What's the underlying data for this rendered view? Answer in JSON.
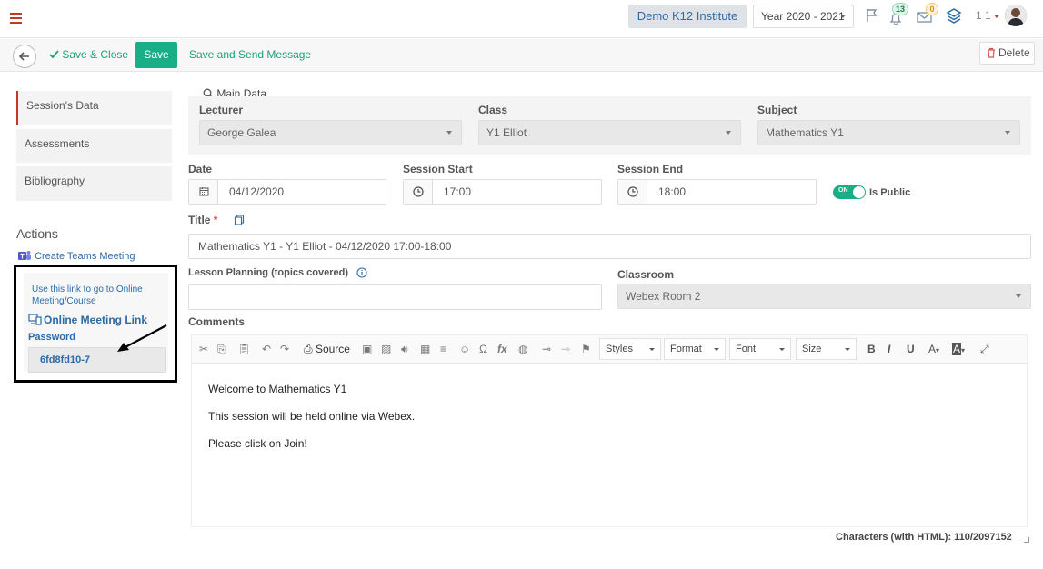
{
  "topbar": {
    "institute": "Demo K12 Institute",
    "year": "Year 2020 - 2021",
    "notifications_count": "13",
    "messages_count": "0",
    "user": "1 1"
  },
  "actionbar": {
    "save_close": "Save & Close",
    "save": "Save",
    "save_send": "Save and Send Message",
    "delete": "Delete"
  },
  "sidebar": {
    "items": [
      {
        "label": "Session's Data"
      },
      {
        "label": "Assessments"
      },
      {
        "label": "Bibliography"
      }
    ],
    "actions_title": "Actions",
    "teams_link": "Create Teams Meeting",
    "link_hint": "Use this link to go to Online Meeting/Course",
    "online_link": "Online Meeting Link",
    "password_label": "Password",
    "password_value": "6fd8fd10-7"
  },
  "main": {
    "section_title": "Main Data",
    "lecturer_label": "Lecturer",
    "lecturer_value": "George Galea",
    "class_label": "Class",
    "class_value": "Y1 Elliot",
    "subject_label": "Subject",
    "subject_value": "Mathematics Y1",
    "date_label": "Date",
    "date_value": "04/12/2020",
    "start_label": "Session Start",
    "start_value": "17:00",
    "end_label": "Session End",
    "end_value": "18:00",
    "toggle_text": "ON",
    "is_public_label": "Is Public",
    "title_label": "Title",
    "title_required": "*",
    "title_value": "Mathematics Y1 - Y1 Elliot - 04/12/2020 17:00-18:00",
    "lesson_label": "Lesson Planning (topics covered)",
    "classroom_label": "Classroom",
    "classroom_value": "Webex Room 2",
    "comments_label": "Comments"
  },
  "editor": {
    "source_label": "Source",
    "styles": "Styles",
    "format": "Format",
    "font": "Font",
    "size": "Size",
    "bold": "B",
    "italic": "I",
    "underline": "U",
    "lines": [
      "Welcome to Mathematics Y1",
      "This session will be held online via Webex.",
      "Please click on Join!"
    ],
    "char_count": "Characters (with HTML): 110/2097152"
  },
  "colors": {
    "accent": "#1aae86",
    "link": "#2c6ba8",
    "danger": "#c0392b"
  }
}
